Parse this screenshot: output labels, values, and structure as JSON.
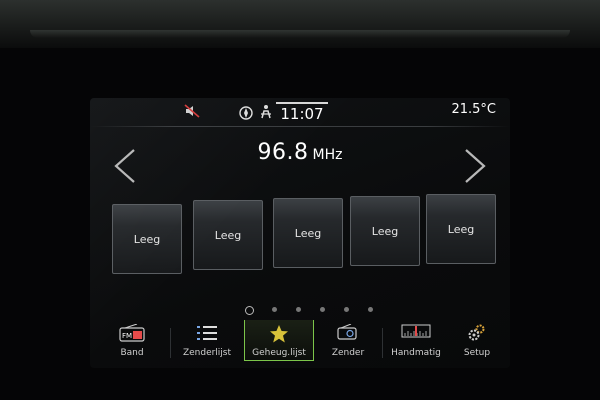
{
  "status": {
    "time": "11:07",
    "temperature": "21.5°C",
    "icons": [
      "mute-icon",
      "compass-icon",
      "seat-icon"
    ]
  },
  "radio": {
    "frequency": "96.8",
    "unit": "MHz"
  },
  "presets": [
    {
      "label": "Leeg"
    },
    {
      "label": "Leeg"
    },
    {
      "label": "Leeg"
    },
    {
      "label": "Leeg"
    },
    {
      "label": "Leeg"
    }
  ],
  "pagination": {
    "pages": 6,
    "current": 1
  },
  "menu": {
    "band": "Band",
    "band_icon_text": "FM",
    "stations": "Zenderlijst",
    "favorites": "Geheug.lijst",
    "station": "Zender",
    "manual": "Handmatig",
    "setup": "Setup"
  },
  "colors": {
    "accent": "#7cc54a",
    "star": "#d8c23a",
    "mute": "#d43c3c"
  }
}
